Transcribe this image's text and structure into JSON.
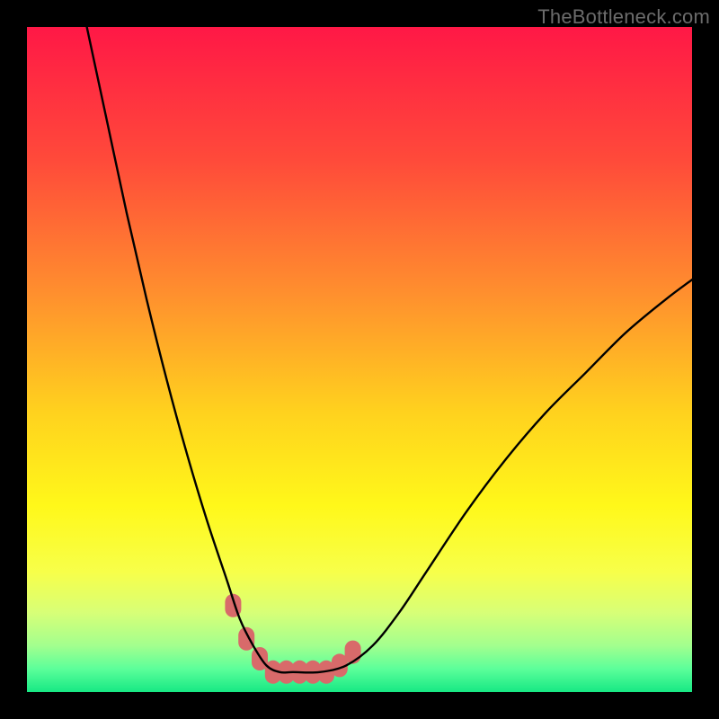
{
  "watermark": "TheBottleneck.com",
  "chart_data": {
    "type": "line",
    "title": "",
    "xlabel": "",
    "ylabel": "",
    "xlim": [
      0,
      100
    ],
    "ylim": [
      0,
      100
    ],
    "series": [
      {
        "name": "bottleneck-curve",
        "x": [
          9,
          12,
          15,
          18,
          21,
          24,
          27,
          30,
          32,
          34,
          36,
          38,
          40,
          44,
          48,
          52,
          56,
          60,
          66,
          72,
          78,
          84,
          90,
          96,
          100
        ],
        "values": [
          100,
          86,
          72,
          59,
          47,
          36,
          26,
          17,
          11,
          7,
          4,
          3,
          3,
          3,
          4,
          7,
          12,
          18,
          27,
          35,
          42,
          48,
          54,
          59,
          62
        ]
      }
    ],
    "markers": {
      "name": "highlighted-range",
      "color": "#d86a6a",
      "x": [
        31,
        33,
        35,
        37,
        39,
        41,
        43,
        45,
        47,
        49
      ],
      "values": [
        13,
        8,
        5,
        3,
        3,
        3,
        3,
        3,
        4,
        6
      ]
    },
    "gradient_stops": [
      {
        "pos": 0.0,
        "color": "#ff1846"
      },
      {
        "pos": 0.2,
        "color": "#ff4a3a"
      },
      {
        "pos": 0.4,
        "color": "#ff8f2e"
      },
      {
        "pos": 0.58,
        "color": "#ffd21e"
      },
      {
        "pos": 0.72,
        "color": "#fff81a"
      },
      {
        "pos": 0.82,
        "color": "#f7ff4a"
      },
      {
        "pos": 0.88,
        "color": "#d8ff77"
      },
      {
        "pos": 0.93,
        "color": "#a3ff8e"
      },
      {
        "pos": 0.965,
        "color": "#5cff9a"
      },
      {
        "pos": 1.0,
        "color": "#17e884"
      }
    ]
  }
}
